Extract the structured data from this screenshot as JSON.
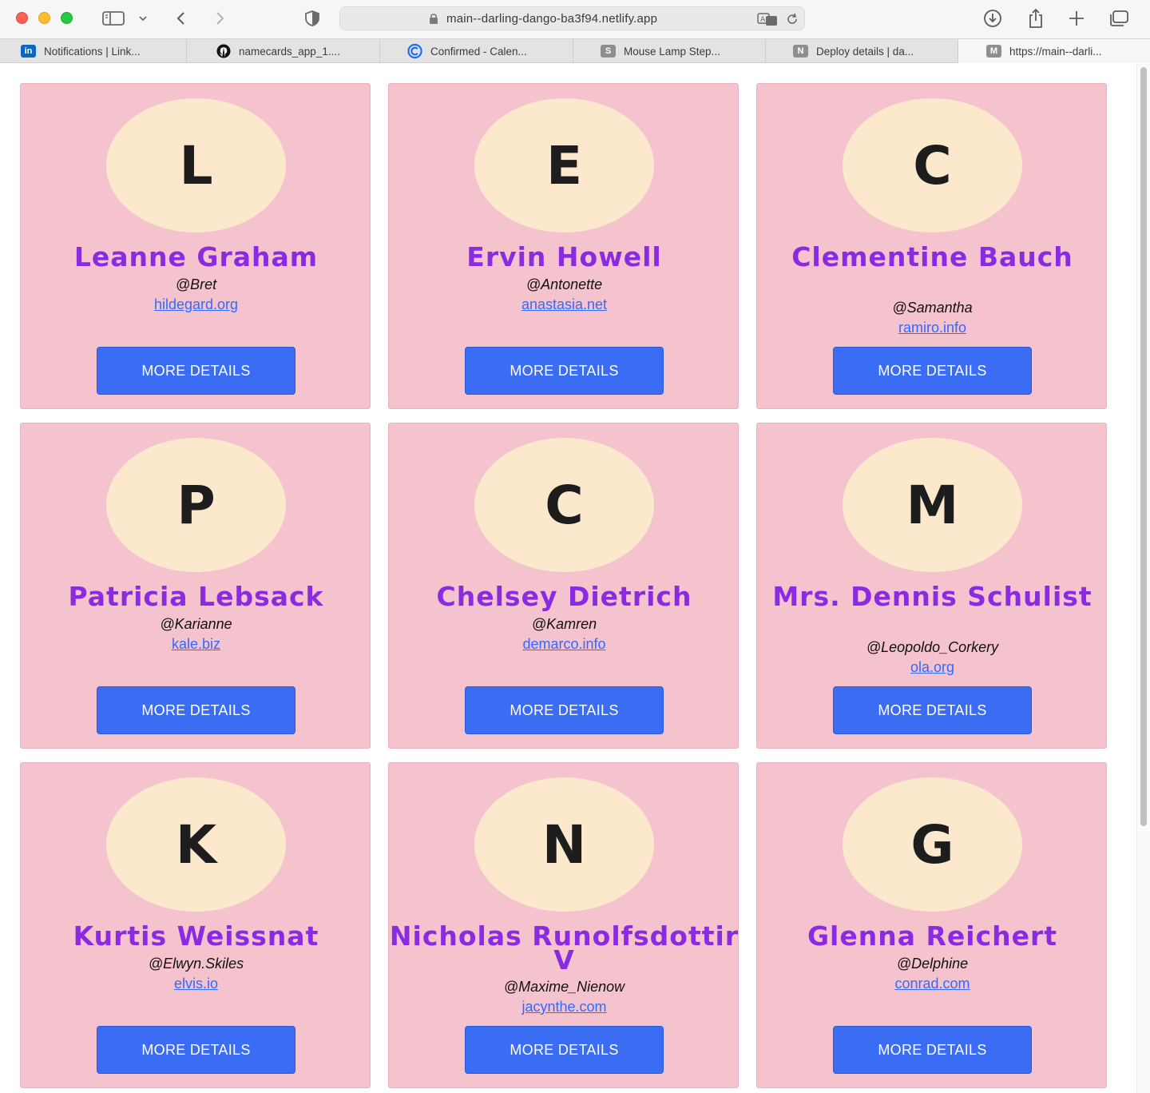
{
  "browser": {
    "url": "main--darling-dango-ba3f94.netlify.app",
    "tabs": [
      {
        "title": "Notifications | Link...",
        "favicon": "linkedin-icon",
        "color": "#0a66c2",
        "glyph": "in"
      },
      {
        "title": "namecards_app_1....",
        "favicon": "github-icon",
        "color": "#111111",
        "glyph": ""
      },
      {
        "title": "Confirmed - Calen...",
        "favicon": "calendly-icon",
        "color": "#1a6cf4",
        "glyph": ""
      },
      {
        "title": "Mouse Lamp Step...",
        "favicon": "s-icon",
        "color": "#8e8e93",
        "glyph": "S"
      },
      {
        "title": "Deploy details | da...",
        "favicon": "n-icon",
        "color": "#8e8e93",
        "glyph": "N"
      },
      {
        "title": "https://main--darli...",
        "favicon": "m-icon",
        "color": "#8e8e93",
        "glyph": "M"
      }
    ]
  },
  "theme": {
    "card_bg": "#f5c3cd",
    "avatar_bg": "#fbe8cd",
    "name_color": "#8a2be2",
    "link_color": "#2f6bff",
    "button_bg": "#3a6cf4"
  },
  "cards": [
    {
      "initial": "L",
      "name": "Leanne Graham",
      "handle": "@Bret",
      "website": "hildegard.org",
      "button": "MORE DETAILS"
    },
    {
      "initial": "E",
      "name": "Ervin Howell",
      "handle": "@Antonette",
      "website": "anastasia.net",
      "button": "MORE DETAILS"
    },
    {
      "initial": "C",
      "name": "Clementine Bauch",
      "handle": "@Samantha",
      "website": "ramiro.info",
      "button": "MORE DETAILS"
    },
    {
      "initial": "P",
      "name": "Patricia Lebsack",
      "handle": "@Karianne",
      "website": "kale.biz",
      "button": "MORE DETAILS"
    },
    {
      "initial": "C",
      "name": "Chelsey Dietrich",
      "handle": "@Kamren",
      "website": "demarco.info",
      "button": "MORE DETAILS"
    },
    {
      "initial": "M",
      "name": "Mrs. Dennis Schulist",
      "handle": "@Leopoldo_Corkery",
      "website": "ola.org",
      "button": "MORE DETAILS"
    },
    {
      "initial": "K",
      "name": "Kurtis Weissnat",
      "handle": "@Elwyn.Skiles",
      "website": "elvis.io",
      "button": "MORE DETAILS"
    },
    {
      "initial": "N",
      "name": "Nicholas Runolfsdottir V",
      "handle": "@Maxime_Nienow",
      "website": "jacynthe.com",
      "button": "MORE DETAILS"
    },
    {
      "initial": "G",
      "name": "Glenna Reichert",
      "handle": "@Delphine",
      "website": "conrad.com",
      "button": "MORE DETAILS"
    }
  ]
}
